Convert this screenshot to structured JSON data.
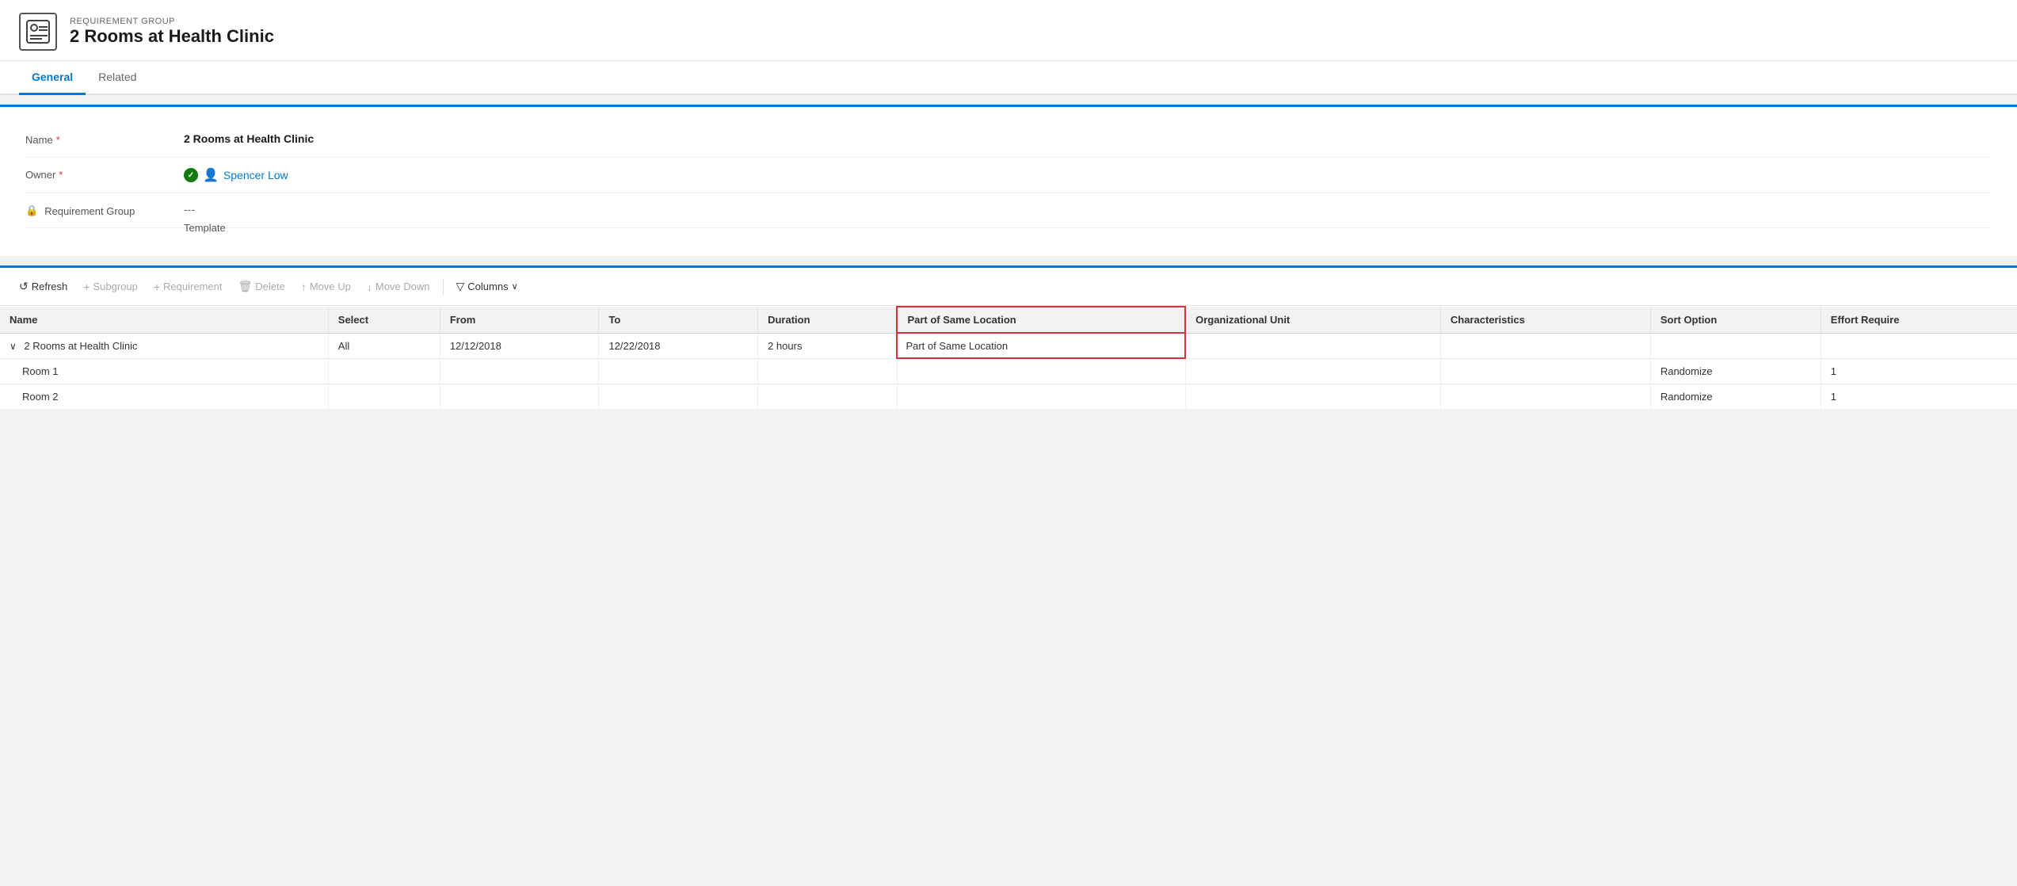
{
  "header": {
    "subtitle": "REQUIREMENT GROUP",
    "title": "2 Rooms at Health Clinic",
    "icon": "📋"
  },
  "tabs": [
    {
      "label": "General",
      "active": true
    },
    {
      "label": "Related",
      "active": false
    }
  ],
  "form": {
    "fields": [
      {
        "label": "Name",
        "required": true,
        "value": "2 Rooms at Health Clinic",
        "type": "text"
      },
      {
        "label": "Owner",
        "required": true,
        "value": "Spencer Low",
        "type": "owner"
      },
      {
        "label": "Requirement Group Template",
        "required": false,
        "value": "---",
        "type": "locked-text"
      }
    ]
  },
  "toolbar": {
    "refresh_label": "Refresh",
    "subgroup_label": "Subgroup",
    "requirement_label": "Requirement",
    "delete_label": "Delete",
    "move_up_label": "Move Up",
    "move_down_label": "Move Down",
    "columns_label": "Columns"
  },
  "grid": {
    "columns": [
      {
        "key": "name",
        "label": "Name"
      },
      {
        "key": "select",
        "label": "Select"
      },
      {
        "key": "from",
        "label": "From"
      },
      {
        "key": "to",
        "label": "To"
      },
      {
        "key": "duration",
        "label": "Duration"
      },
      {
        "key": "part_of_same",
        "label": "Part of Same Location",
        "highlighted": true
      },
      {
        "key": "org_unit",
        "label": "Organizational Unit"
      },
      {
        "key": "characteristics",
        "label": "Characteristics"
      },
      {
        "key": "sort_option",
        "label": "Sort Option"
      },
      {
        "key": "effort_required",
        "label": "Effort Require"
      }
    ],
    "rows": [
      {
        "name": "2 Rooms at Health Clinic",
        "indent": false,
        "expandable": true,
        "select": "All",
        "from": "12/12/2018",
        "to": "12/22/2018",
        "duration": "2 hours",
        "part_of_same": "Part of Same Location",
        "highlighted_row": true,
        "org_unit": "",
        "characteristics": "",
        "sort_option": "",
        "effort_required": ""
      },
      {
        "name": "Room 1",
        "indent": true,
        "expandable": false,
        "select": "",
        "from": "",
        "to": "",
        "duration": "",
        "part_of_same": "",
        "highlighted_row": false,
        "org_unit": "",
        "characteristics": "",
        "sort_option": "Randomize",
        "effort_required": "1"
      },
      {
        "name": "Room 2",
        "indent": true,
        "expandable": false,
        "select": "",
        "from": "",
        "to": "",
        "duration": "",
        "part_of_same": "",
        "highlighted_row": false,
        "org_unit": "",
        "characteristics": "",
        "sort_option": "Randomize",
        "effort_required": "1"
      }
    ]
  }
}
